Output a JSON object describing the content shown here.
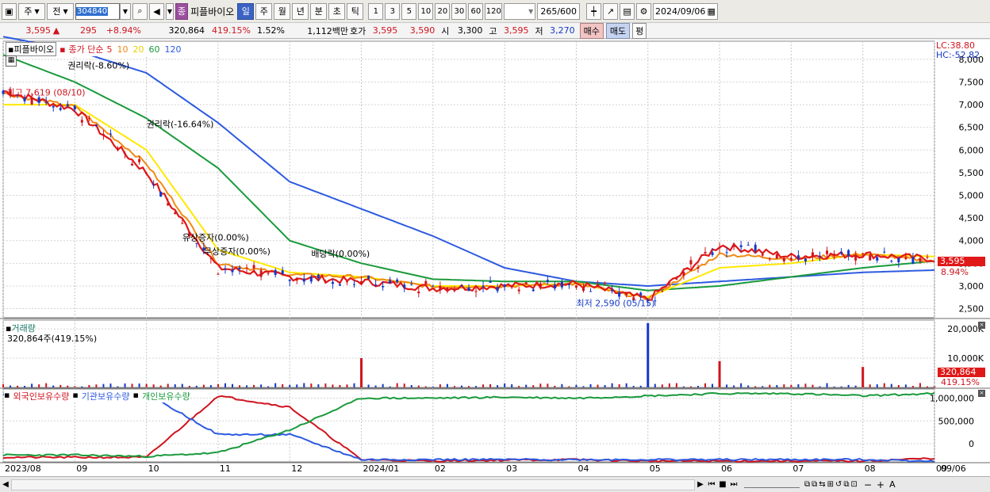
{
  "toolbar": {
    "market": "주",
    "prev": "전",
    "code": "304840",
    "company_tag": "종",
    "company": "피플바이오",
    "periods": [
      "일",
      "주",
      "월",
      "년",
      "분",
      "초",
      "틱"
    ],
    "active_period": "일",
    "intervals": [
      "1",
      "3",
      "5",
      "10",
      "20",
      "30",
      "60",
      "120"
    ],
    "count": "265",
    "count_max": "/600",
    "date": "2024/09/06"
  },
  "quote": {
    "price": "3,595",
    "arrow": "▲",
    "change": "295",
    "rate": "+8.94%",
    "volume": "320,864",
    "vol_rate": "419.15%",
    "turnover": "1.52%",
    "amount": "1,112백만",
    "hoga_label": "호가",
    "ask": "3,595",
    "bid": "3,590",
    "open_label": "시",
    "open": "3,300",
    "high_label": "고",
    "high": "3,595",
    "low_label": "저",
    "low": "3,270",
    "buy_label": "매수",
    "sell_label": "매도",
    "avg_label": "평"
  },
  "price_panel": {
    "legend_name": "피플바이오",
    "legend_type": "종가 단순",
    "ma": [
      {
        "label": "5",
        "color": "#e01818"
      },
      {
        "label": "10",
        "color": "#f08a14"
      },
      {
        "label": "20",
        "color": "#ffe800"
      },
      {
        "label": "60",
        "color": "#1a9a3c"
      },
      {
        "label": "120",
        "color": "#2c5ae0"
      }
    ],
    "lc": "LC:38.80",
    "hc": "HC:-52.82",
    "yticks": [
      "8,000",
      "7,500",
      "7,000",
      "6,500",
      "6,000",
      "5,500",
      "5,000",
      "4,500",
      "4,000",
      "3,500",
      "3,000",
      "2,500"
    ],
    "last_price": "3,595",
    "last_rate": "8.94%",
    "annotations": [
      {
        "text": "권리락(-8.60%)",
        "color": "#000"
      },
      {
        "text": "최고 7,619 (08/10)",
        "color": "#d0141e"
      },
      {
        "text": "권리락(-16.64%)",
        "color": "#000"
      },
      {
        "text": "유상증자(0.00%)",
        "color": "#000"
      },
      {
        "text": "무상증자(0.00%)",
        "color": "#000"
      },
      {
        "text": "배당락(0.00%)",
        "color": "#000"
      },
      {
        "text": "최저 2,590 (05/15)",
        "color": "#1438c8"
      }
    ]
  },
  "volume_panel": {
    "title": "거래량",
    "value": "320,864주(419.15%)",
    "yticks": [
      "20,000K",
      "10,000K"
    ],
    "last": "320,864",
    "last_rate": "419.15%"
  },
  "holdings_panel": {
    "legends": [
      {
        "label": "외국인보유수량",
        "color": "#d0141e"
      },
      {
        "label": "기관보유수량",
        "color": "#2c5ae0"
      },
      {
        "label": "개인보유수량",
        "color": "#1a9a3c"
      }
    ],
    "yticks": [
      "1,000,000",
      "500,000",
      "0"
    ]
  },
  "xaxis": {
    "labels": [
      "2023/08",
      "09",
      "10",
      "11",
      "12",
      "2024/01",
      "02",
      "03",
      "04",
      "05",
      "06",
      "07",
      "08",
      "09"
    ],
    "last": "09/06"
  },
  "chart_data": [
    {
      "type": "line",
      "title": "피플바이오 종가 단순",
      "x": [
        "2023/08",
        "2023/09",
        "2023/10",
        "2023/11",
        "2023/12",
        "2024/01",
        "2024/02",
        "2024/03",
        "2024/04",
        "2024/05",
        "2024/06",
        "2024/07",
        "2024/08",
        "2024/09"
      ],
      "series": [
        {
          "name": "5",
          "values": [
            7300,
            6900,
            5500,
            3400,
            3200,
            3100,
            2950,
            3000,
            3050,
            2700,
            3900,
            3650,
            3700,
            3595
          ]
        },
        {
          "name": "10",
          "values": [
            7250,
            6950,
            5700,
            3500,
            3250,
            3200,
            2980,
            3000,
            3050,
            2720,
            3700,
            3600,
            3700,
            3550
          ]
        },
        {
          "name": "20",
          "values": [
            7000,
            7000,
            6000,
            3800,
            3300,
            3200,
            3000,
            3000,
            3050,
            2750,
            3400,
            3500,
            3700,
            3650
          ]
        },
        {
          "name": "60",
          "values": [
            8100,
            7500,
            6700,
            5600,
            4000,
            3500,
            3150,
            3100,
            3100,
            2900,
            3000,
            3200,
            3400,
            3550
          ]
        },
        {
          "name": "120",
          "values": [
            8500,
            8200,
            7700,
            6600,
            5300,
            4700,
            4100,
            3400,
            3100,
            3000,
            3100,
            3200,
            3300,
            3350
          ]
        }
      ],
      "ylim": [
        2300,
        8400
      ],
      "high": {
        "value": 7619,
        "date": "08/10"
      },
      "low": {
        "value": 2590,
        "date": "05/15"
      }
    },
    {
      "type": "bar",
      "title": "거래량",
      "ylim": [
        0,
        23000000
      ],
      "spikes": [
        {
          "x": "2024/01",
          "value": 10000000
        },
        {
          "x": "2024/05",
          "value": 22000000
        },
        {
          "x": "2024/06",
          "value": 9000000
        },
        {
          "x": "2024/08",
          "value": 7000000
        },
        {
          "x": "2024/09",
          "value": 320864
        }
      ]
    },
    {
      "type": "line",
      "title": "보유수량",
      "ylim": [
        -400000,
        1200000
      ],
      "series": [
        {
          "name": "외국인보유수량",
          "values": [
            -300000,
            -300000,
            -300000,
            1050000,
            800000,
            -350000,
            -380000,
            -360000,
            -350000,
            -380000,
            -380000,
            -380000,
            -380000,
            -320000
          ]
        },
        {
          "name": "기관보유수량",
          "values": [
            1100000,
            1100000,
            1100000,
            200000,
            200000,
            -350000,
            -350000,
            -350000,
            -350000,
            -350000,
            -350000,
            -350000,
            -350000,
            -380000
          ]
        },
        {
          "name": "개인보유수량",
          "values": [
            -250000,
            -250000,
            -280000,
            -200000,
            300000,
            1000000,
            1000000,
            1020000,
            1000000,
            1050000,
            1100000,
            1100000,
            1050000,
            1100000
          ]
        }
      ]
    }
  ]
}
